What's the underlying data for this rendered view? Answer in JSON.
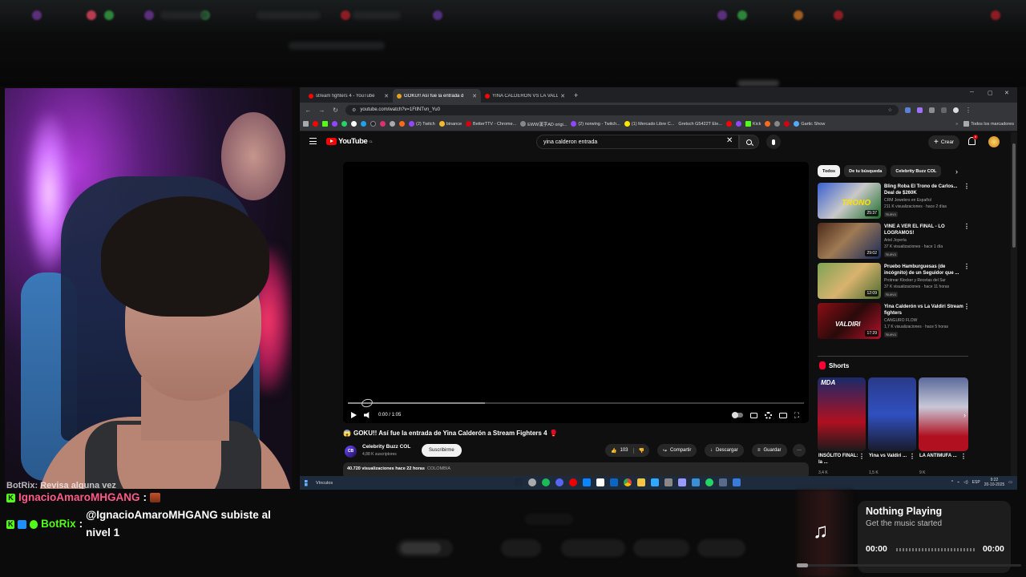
{
  "browser": {
    "tabs": [
      {
        "label": "stream fighters 4 - YouTube"
      },
      {
        "label": "GOKU!! Así fue la entrada d"
      },
      {
        "label": "YINA CALDERÓN VS LA VALDI"
      }
    ],
    "new_tab": "+",
    "url": "youtube.com/watch?v=1FtlNTvn_Yu0",
    "bookmarks": [
      "(2) Twitch",
      "binance",
      "BetterTTV - Chrome...",
      "EWW漢字AD origi...",
      "(2) norwing - Twitch...",
      "(1) Mercado Libre C...",
      "Gretsch G5422T Ele...",
      "Kick",
      "Gartic Show"
    ],
    "all_bookmarks": "Todos los marcadores"
  },
  "youtube": {
    "logo": "YouTube",
    "logo_region": "CL",
    "search_value": "yina calderon entrada",
    "create_label": "Crear",
    "notifications": "9",
    "player": {
      "time": "0:00 / 1:05",
      "progress_buffered": 0.3
    },
    "video": {
      "title_emoji": "😱",
      "title": "GOKU!! Así fue la entrada de Yina Calderón a Stream Fighters 4",
      "title_emoji_end": "🥊",
      "channel_initials": "CB",
      "channel": "Celebrity Buzz COL",
      "subscribers": "4,88 K suscriptores",
      "subscribe_label": "Suscribirme",
      "likes": "103",
      "share_label": "Compartir",
      "download_label": "Descargar",
      "save_label": "Guardar",
      "more_label": "···",
      "views": "40.720 visualizaciones  hace 22 horas",
      "location": "COLOMBIA"
    },
    "chips": [
      "Todos",
      "De tu búsqueda",
      "Celebrity Buzz COL"
    ],
    "recommendations": [
      {
        "title": "Bling Roba El Trono de Carlos... Deal de $260K",
        "channel": "CRM Jewelers en Español",
        "meta": "211 K visualizaciones · hace 2 días",
        "badge": "Nuevo",
        "duration": "25:37",
        "thumb_text": "TRONO"
      },
      {
        "title": "VINE A VER EL FINAL - LO LOGRAMOS!",
        "channel": "Ariel Joyería",
        "meta": "37 K visualizaciones · hace 1 día",
        "badge": "Nuevo",
        "duration": "29:02",
        "thumb_text": ""
      },
      {
        "title": "Pruebo Hamburguesas (de incógnito) de un Seguidor que ...",
        "channel": "Protrear Klocker y Recetas del Sur",
        "meta": "37 K visualizaciones · hace 11 horas",
        "badge": "Nuevo",
        "duration": "12:09",
        "thumb_text": ""
      },
      {
        "title": "Yina Calderón vs La Valdiri Stream fighters",
        "channel": "CANGURO FLOW",
        "meta": "1,7 K visualizaciones · hace 5 horas",
        "badge": "Nuevo",
        "duration": "17:29",
        "thumb_text": "VALDIRI"
      }
    ],
    "shorts_label": "Shorts",
    "shorts": [
      {
        "title": "INSÓLITO FINAL: la ...",
        "meta": "3,4 K",
        "thumb_text": "MDA"
      },
      {
        "title": "Yina vs Valdiri ...",
        "meta": "1,5 K",
        "thumb_text": ""
      },
      {
        "title": "LA ANTIMUFA ...",
        "meta": "9 K",
        "thumb_text": ""
      }
    ]
  },
  "taskbar": {
    "label": "Vínculos",
    "lang": "ESP",
    "time": "9:22",
    "date": "20-10-2025"
  },
  "chat": [
    {
      "user": "Ignacio Amaro MHGANG",
      "display": "IgnacioAmaroMHGANG",
      "text": "",
      "user_color": "#ff5a8a"
    },
    {
      "user": "BotRix",
      "display": "BotRix",
      "text": "@IgnacioAmaroMHGANG subiste al nivel 1",
      "user_color": "#53fc18"
    }
  ],
  "chat_partial_top": "BotRix: Revisa alguna vez",
  "music": {
    "title": "Nothing Playing",
    "subtitle": "Get the music started",
    "time_current": "00:00",
    "time_total": "00:00",
    "progress": 0
  }
}
